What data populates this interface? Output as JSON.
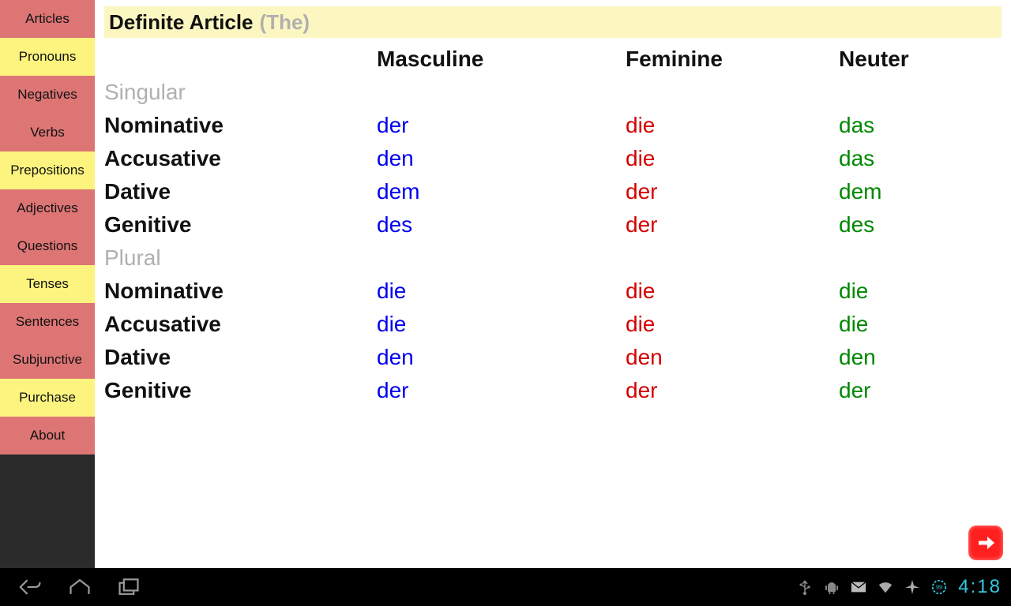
{
  "sidebar": {
    "items": [
      {
        "label": "Articles",
        "variant": "red"
      },
      {
        "label": "Pronouns",
        "variant": "yellow"
      },
      {
        "label": "Negatives",
        "variant": "red"
      },
      {
        "label": "Verbs",
        "variant": "red"
      },
      {
        "label": "Prepositions",
        "variant": "yellow"
      },
      {
        "label": "Adjectives",
        "variant": "red"
      },
      {
        "label": "Questions",
        "variant": "red"
      },
      {
        "label": "Tenses",
        "variant": "yellow"
      },
      {
        "label": "Sentences",
        "variant": "red"
      },
      {
        "label": "Subjunctive",
        "variant": "red"
      },
      {
        "label": "Purchase",
        "variant": "yellow"
      },
      {
        "label": "About",
        "variant": "red"
      }
    ]
  },
  "title": {
    "main": "Definite Article",
    "sub": "(The)"
  },
  "columns": {
    "masculine": "Masculine",
    "feminine": "Feminine",
    "neuter": "Neuter"
  },
  "sections": [
    {
      "label": "Singular",
      "rows": [
        {
          "case": "Nominative",
          "m": "der",
          "f": "die",
          "n": "das"
        },
        {
          "case": "Accusative",
          "m": "den",
          "f": "die",
          "n": "das"
        },
        {
          "case": "Dative",
          "m": "dem",
          "f": "der",
          "n": "dem"
        },
        {
          "case": "Genitive",
          "m": "des",
          "f": "der",
          "n": "des"
        }
      ]
    },
    {
      "label": "Plural",
      "rows": [
        {
          "case": "Nominative",
          "m": "die",
          "f": "die",
          "n": "die"
        },
        {
          "case": "Accusative",
          "m": "die",
          "f": "die",
          "n": "die"
        },
        {
          "case": "Dative",
          "m": "den",
          "f": "den",
          "n": "den"
        },
        {
          "case": "Genitive",
          "m": "der",
          "f": "der",
          "n": "der"
        }
      ]
    }
  ],
  "statusbar": {
    "time": "4:18"
  }
}
